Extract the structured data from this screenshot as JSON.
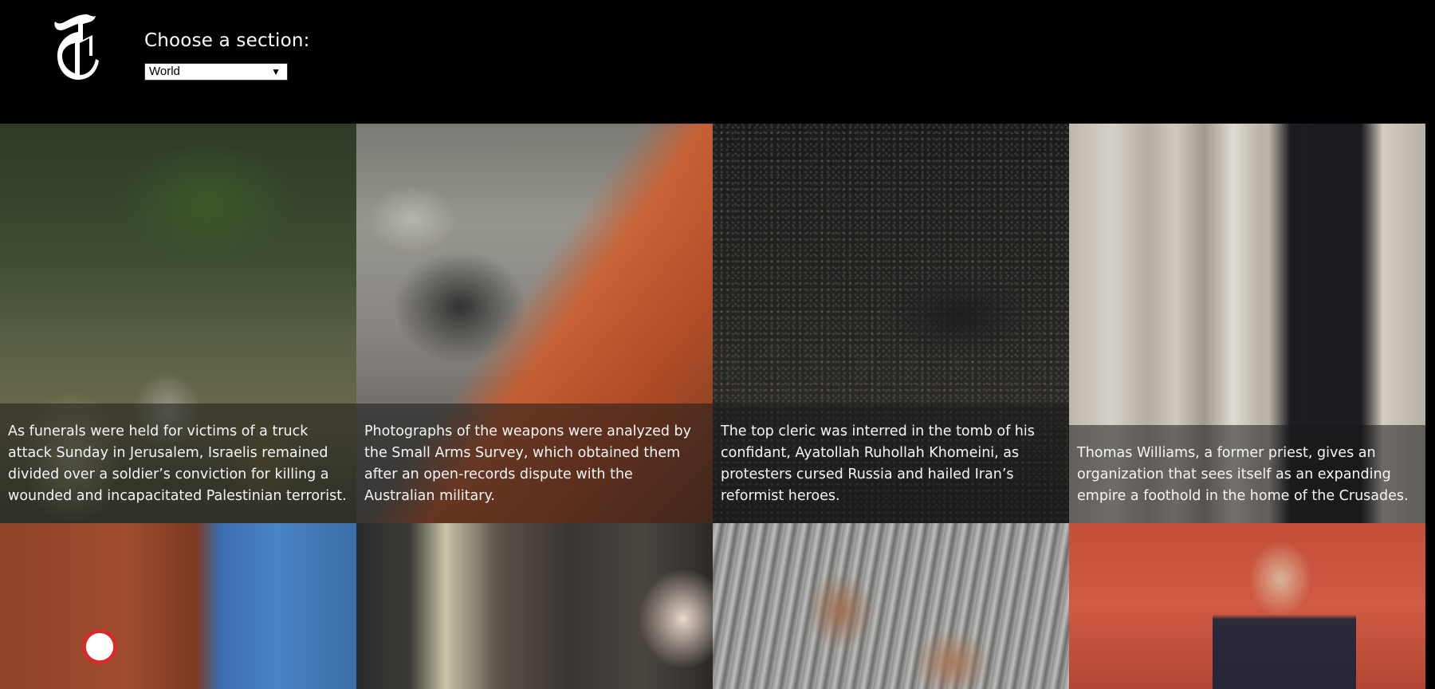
{
  "header": {
    "logo": "nyt-logo-icon",
    "section_label": "Choose a section:",
    "section_selected": "World"
  },
  "stories": [
    {
      "caption": "As funerals were held for victims of a truck attack Sunday in Jerusalem, Israelis remained divided over a soldier’s conviction for killing a wounded and incapacitated Palestinian terrorist."
    },
    {
      "caption": "Photographs of the weapons were analyzed by the Small Arms Survey, which obtained them after an open-records dispute with the Australian military."
    },
    {
      "caption": "The top cleric was interred in the tomb of his confidant, Ayatollah Ruhollah Khomeini, as protesters cursed Russia and hailed Iran’s reformist heroes."
    },
    {
      "caption": "Thomas Williams, a former priest, gives an organization that sees itself as an expanding empire a foothold in the home of the Crusades."
    },
    {
      "caption": ""
    },
    {
      "caption": ""
    },
    {
      "caption": ""
    },
    {
      "caption": ""
    }
  ]
}
